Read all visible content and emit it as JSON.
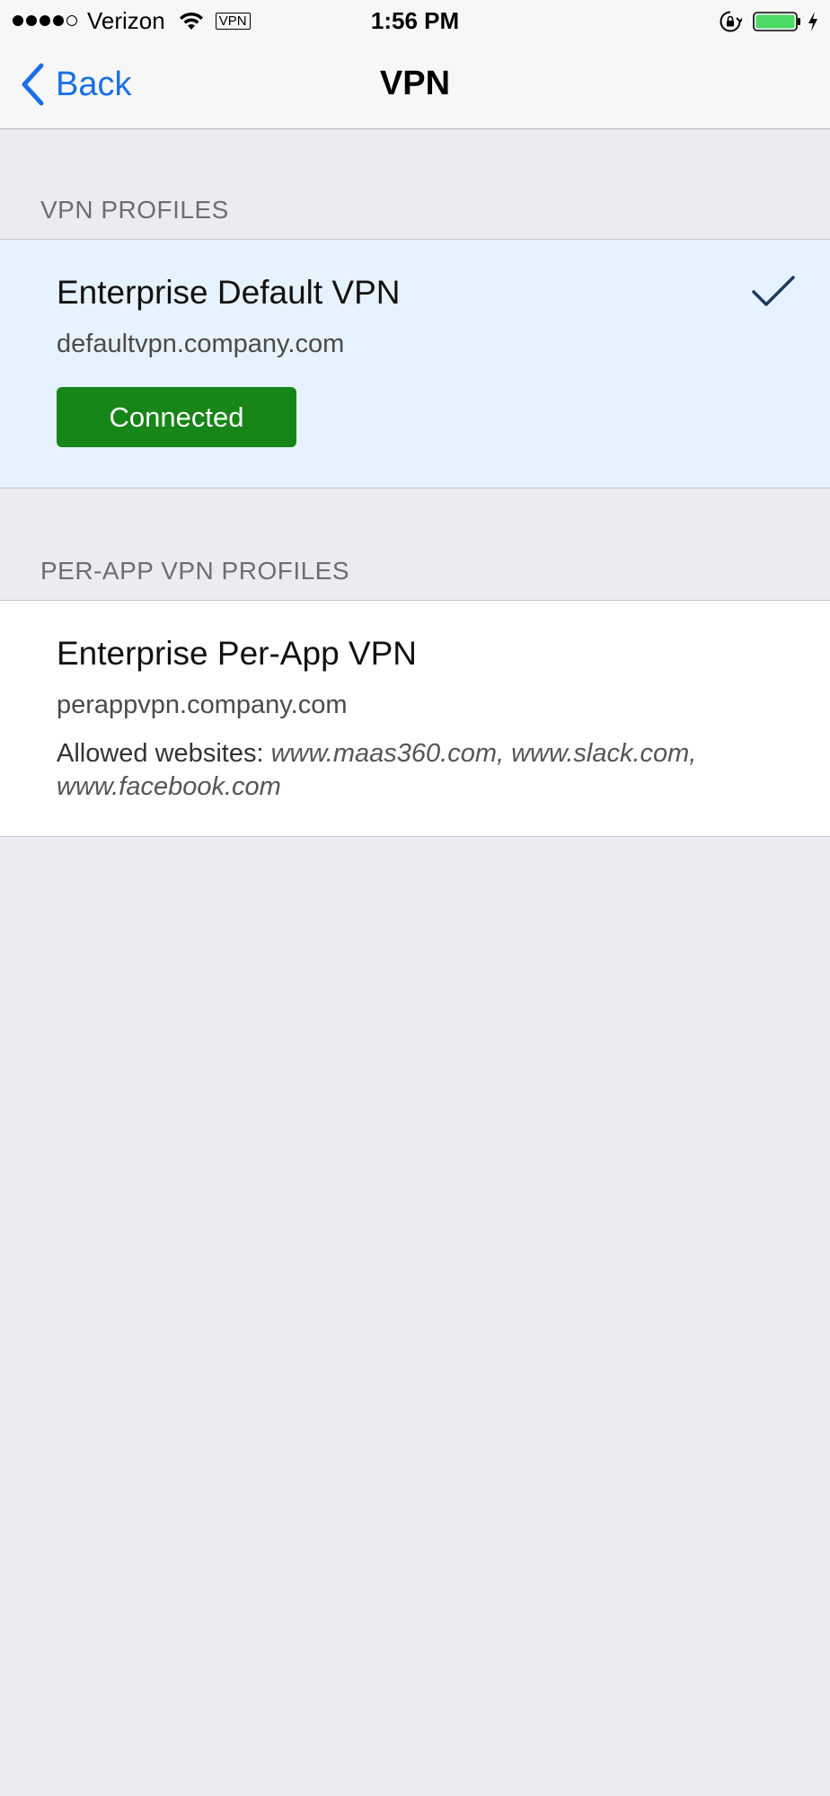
{
  "status_bar": {
    "carrier": "Verizon",
    "vpn_badge": "VPN",
    "time": "1:56 PM",
    "battery_color": "#4cd964"
  },
  "nav": {
    "back_label": "Back",
    "title": "VPN",
    "accent_color": "#1a6fe6"
  },
  "sections": {
    "vpn_profiles": {
      "header": "VPN PROFILES",
      "profile": {
        "name": "Enterprise Default VPN",
        "host": "defaultvpn.company.com",
        "status": "Connected",
        "status_color": "#178518",
        "selected_icon": "checkmark-icon"
      }
    },
    "per_app_profiles": {
      "header": "PER-APP VPN PROFILES",
      "profile": {
        "name": "Enterprise Per-App VPN",
        "host": "perappvpn.company.com",
        "allowed_label": "Allowed websites:",
        "allowed_list": "www.maas360.com, www.slack.com, www.facebook.com"
      }
    }
  }
}
